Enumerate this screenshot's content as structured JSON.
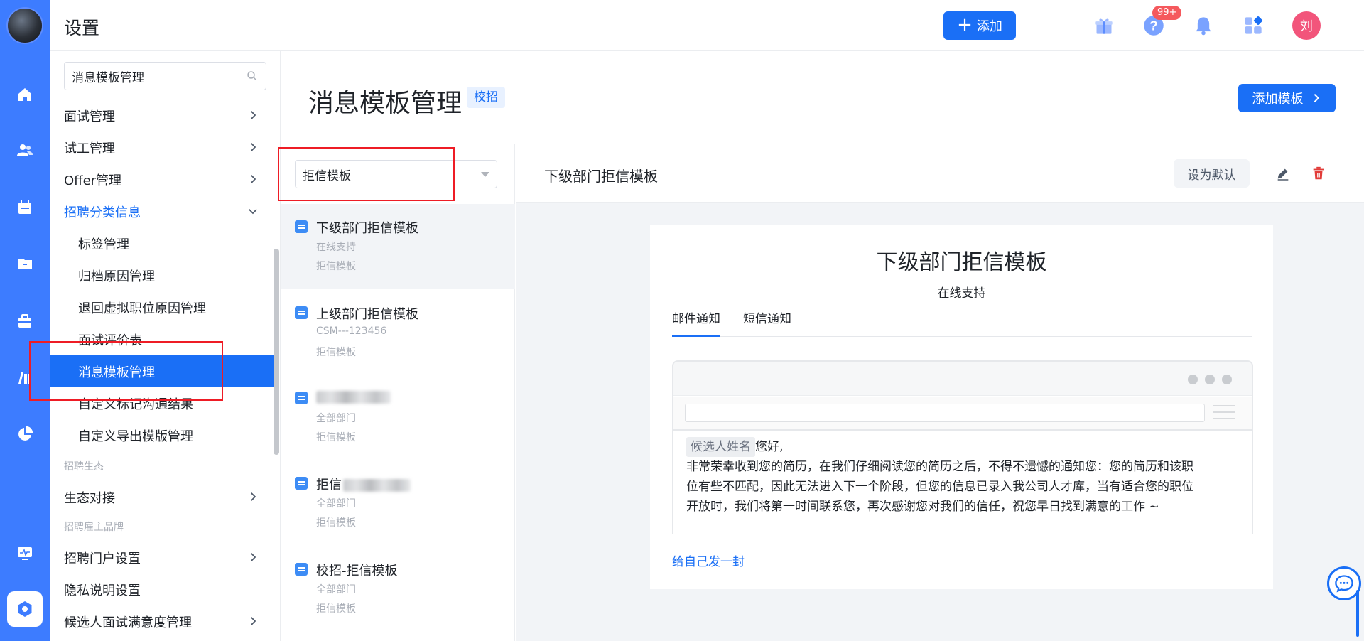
{
  "app": {
    "page_title": "设置",
    "add_button": "添加",
    "notification_count": "99+",
    "user_initial": "刘",
    "brand_color": "#1a6ff6",
    "rail_color": "#3d7cff"
  },
  "rail": {
    "icons": [
      "home-icon",
      "users-icon",
      "calendar-icon",
      "folder-icon",
      "briefcase-icon",
      "library-icon",
      "pie-chart-icon",
      "monitor-icon",
      "settings-icon"
    ]
  },
  "menu": {
    "search_value": "消息模板管理",
    "items": [
      {
        "label": "面试管理"
      },
      {
        "label": "试工管理"
      },
      {
        "label": "Offer管理"
      },
      {
        "label": "招聘分类信息"
      },
      {
        "label": "标签管理"
      },
      {
        "label": "归档原因管理"
      },
      {
        "label": "退回虚拟职位原因管理"
      },
      {
        "label": "面试评价表"
      },
      {
        "label": "消息模板管理"
      },
      {
        "label": "自定义标记沟通结果"
      },
      {
        "label": "自定义导出模版管理"
      },
      {
        "label": "招聘生态"
      },
      {
        "label": "生态对接"
      },
      {
        "label": "招聘雇主品牌"
      },
      {
        "label": "招聘门户设置"
      },
      {
        "label": "隐私说明设置"
      },
      {
        "label": "候选人面试满意度管理"
      }
    ]
  },
  "main": {
    "title": "消息模板管理",
    "tag": "校招",
    "add_template_button": "添加模板",
    "filter_select": "拒信模板",
    "templates": [
      {
        "name": "下级部门拒信模板",
        "dept": "在线支持",
        "type": "拒信模板"
      },
      {
        "name": "上级部门拒信模板",
        "dept": "CSM---123456",
        "type": "拒信模板"
      },
      {
        "name": "",
        "dept": "全部部门",
        "type": "拒信模板"
      },
      {
        "name": "拒信",
        "dept": "全部部门",
        "type": "拒信模板"
      },
      {
        "name": "校招-拒信模板",
        "dept": "全部部门",
        "type": "拒信模板"
      }
    ]
  },
  "detail": {
    "header_title": "下级部门拒信模板",
    "set_default_button": "设为默认",
    "card_title": "下级部门拒信模板",
    "card_subtitle": "在线支持",
    "tabs": [
      "邮件通知",
      "短信通知"
    ],
    "mail_variable": "候选人姓名",
    "mail_greeting": "您好,",
    "mail_body_1": "非常荣幸收到您的简历，在我们仔细阅读您的简历之后，不得不遗憾的通知您：您的简历和该职",
    "mail_body_2": "位有些不匹配，因此无法进入下一个阶段，但您的信息已录入我公司人才库，当有适合您的职位",
    "mail_body_3": "开放时，我们将第一时间联系您，再次感谢您对我们的信任，祝您早日找到满意的工作 ~",
    "send_self_link": "给自己发一封"
  }
}
